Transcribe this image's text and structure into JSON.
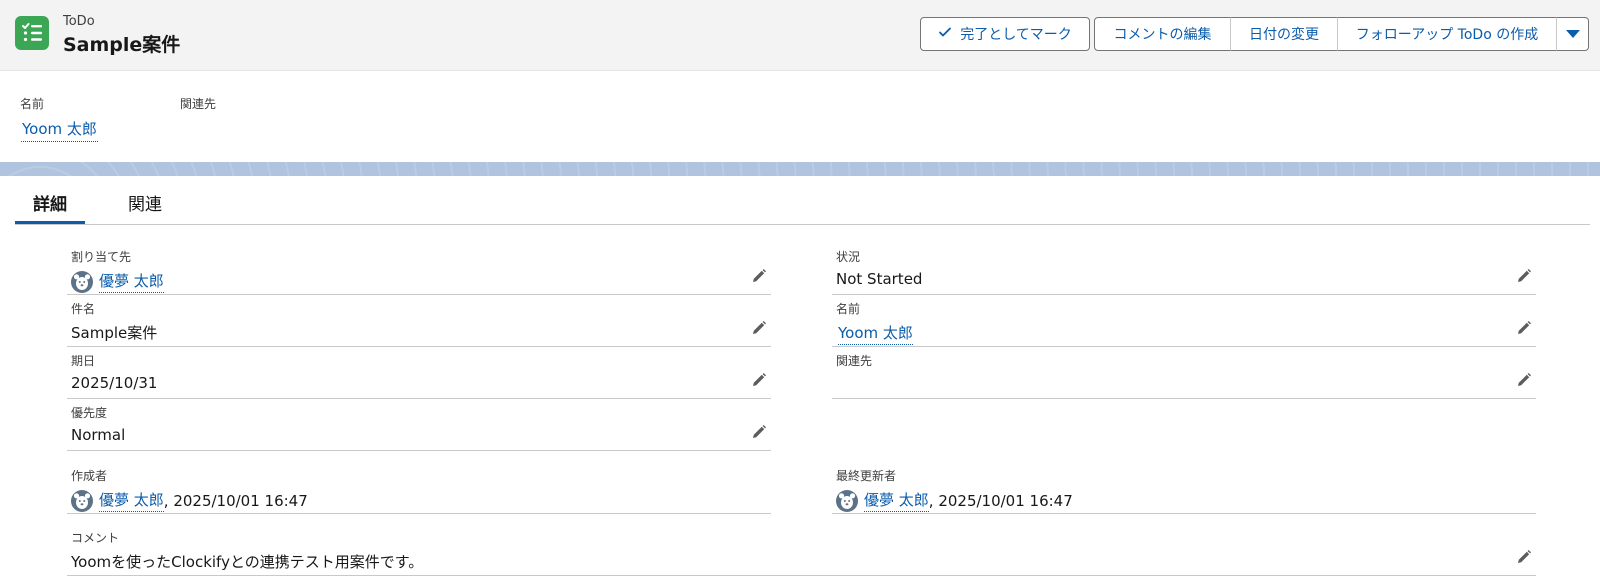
{
  "header": {
    "object_type": "ToDo",
    "record_title": "Sample案件",
    "icon": "task-list-icon",
    "actions": {
      "mark_complete": "完了としてマーク",
      "edit_comment": "コメントの編集",
      "change_date": "日付の変更",
      "create_followup": "フォローアップ ToDo の作成",
      "more_icon": "chevron-down-icon"
    }
  },
  "highlights": {
    "name_label": "名前",
    "name_value": "Yoom 太郎",
    "related_label": "関連先",
    "related_value": ""
  },
  "tabs": [
    "詳細",
    "関連"
  ],
  "details": {
    "assigned_to": {
      "label": "割り当て先",
      "value": "優夢 太郎"
    },
    "subject": {
      "label": "件名",
      "value": "Sample案件"
    },
    "due_date": {
      "label": "期日",
      "value": "2025/10/31"
    },
    "priority": {
      "label": "優先度",
      "value": "Normal"
    },
    "status": {
      "label": "状況",
      "value": "Not Started"
    },
    "name": {
      "label": "名前",
      "value": "Yoom 太郎"
    },
    "related_to": {
      "label": "関連先",
      "value": ""
    },
    "created_by": {
      "label": "作成者",
      "user": "優夢 太郎",
      "timestamp": ", 2025/10/01 16:47"
    },
    "last_modified_by": {
      "label": "最終更新者",
      "user": "優夢 太郎",
      "timestamp": ", 2025/10/01 16:47"
    },
    "comment": {
      "label": "コメント",
      "value": "Yoomを使ったClockifyとの連携テスト用案件です。"
    }
  },
  "colors": {
    "brand_link": "#0b5cab",
    "task_icon_bg": "#3ba755",
    "band": "#b0c4df"
  }
}
